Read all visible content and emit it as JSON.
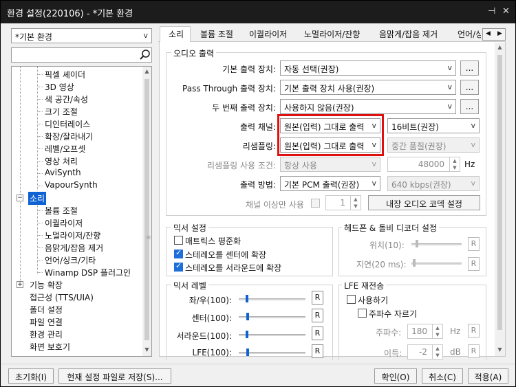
{
  "window": {
    "title": "환경 설정(220106) - *기본 환경",
    "pin": "⊣",
    "close": "✕"
  },
  "left": {
    "preset": "*기본 환경",
    "search_value": "",
    "tree": [
      {
        "label": "픽셀 셰이더",
        "level": 2
      },
      {
        "label": "3D 영상",
        "level": 2
      },
      {
        "label": "색 공간/속성",
        "level": 2
      },
      {
        "label": "크기 조절",
        "level": 2
      },
      {
        "label": "디인터레이스",
        "level": 2
      },
      {
        "label": "확장/잘라내기",
        "level": 2
      },
      {
        "label": "레벨/오프셋",
        "level": 2
      },
      {
        "label": "영상 처리",
        "level": 2
      },
      {
        "label": "AviSynth",
        "level": 2
      },
      {
        "label": "VapourSynth",
        "level": 2
      },
      {
        "label": "소리",
        "level": 1,
        "selected": true,
        "expander": "−"
      },
      {
        "label": "볼륨 조절",
        "level": 2
      },
      {
        "label": "이퀄라이저",
        "level": 2
      },
      {
        "label": "노멀라이저/잔향",
        "level": 2
      },
      {
        "label": "음맑게/잡음 제거",
        "level": 2
      },
      {
        "label": "언어/싱크/기타",
        "level": 2
      },
      {
        "label": "Winamp DSP 플러그인",
        "level": 2
      },
      {
        "label": "기능 확장",
        "level": 1,
        "expander": "+"
      },
      {
        "label": "접근성 (TTS/UIA)",
        "level": 1
      },
      {
        "label": "폴더 설정",
        "level": 1
      },
      {
        "label": "파일 연결",
        "level": 1
      },
      {
        "label": "환경 관리",
        "level": 1
      },
      {
        "label": "화면 보호기",
        "level": 1
      }
    ]
  },
  "tabs": [
    "소리",
    "볼륨 조절",
    "이퀄라이저",
    "노멀라이저/잔향",
    "음맑게/잡음 제거",
    "언어/싱"
  ],
  "audio_output": {
    "title": "오디오 출력",
    "default_device_label": "기본 출력 장치:",
    "default_device_value": "자동 선택(권장)",
    "passthrough_label": "Pass Through 출력 장치:",
    "passthrough_value": "기본 출력 장치 사용(권장)",
    "second_device_label": "두 번째 출력 장치:",
    "second_device_value": "사용하지 않음(권장)",
    "more": "...",
    "channel_label": "출력 채널:",
    "channel_value": "원본(입력) 그대로 출력",
    "bits_value": "16비트(권장)",
    "resample_label": "리샘플링:",
    "resample_value": "원본(입력) 그대로 출력",
    "quality_value": "중간 품질(권장)",
    "resample_cond_label": "리샘플링 사용 조건:",
    "resample_cond_value": "항상 사용",
    "rate_value": "48000",
    "rate_unit": "Hz",
    "method_label": "출력 방법:",
    "method_value": "기본 PCM 출력(권장)",
    "bitrate_value": "640 kbps(권장)",
    "channel_over_label": "채널 이상만 사용",
    "channel_over_value": "1",
    "codec_button": "내장 오디오 코덱 설정"
  },
  "mixer_settings": {
    "title": "믹서 설정",
    "items": [
      {
        "label": "매트릭스 평준화",
        "checked": false
      },
      {
        "label": "스테레오를 센터에 확장",
        "checked": true
      },
      {
        "label": "스테레오를 서라운드에 확장",
        "checked": true
      }
    ]
  },
  "headphone": {
    "title": "헤드폰 & 돌비 디코더 설정",
    "position_label": "위치(10):",
    "delay_label": "지연(20 ms):",
    "reset": "R"
  },
  "mixer_level": {
    "title": "믹서 레벨",
    "items": [
      {
        "label": "좌/우(100):"
      },
      {
        "label": "센터(100):"
      },
      {
        "label": "서라운드(100):"
      },
      {
        "label": "LFE(100):"
      }
    ],
    "reset": "R"
  },
  "lfe": {
    "title": "LFE 재전송",
    "use_label": "사용하기",
    "cutoff_label": "주파수 자르기",
    "freq_label": "주파수:",
    "freq_value": "180",
    "freq_unit": "Hz",
    "gain_label": "이득:",
    "gain_value": "-2",
    "gain_unit": "dB",
    "reset": "R"
  },
  "footer": {
    "reset": "초기화(I)",
    "save": "현재 설정 파일로 저장(S)...",
    "ok": "확인(O)",
    "cancel": "취소(C)",
    "apply": "적용(A)"
  },
  "colors": {
    "highlight": "#e01010",
    "selection": "#0f62d4",
    "titlebar": "#1c1c1c"
  }
}
